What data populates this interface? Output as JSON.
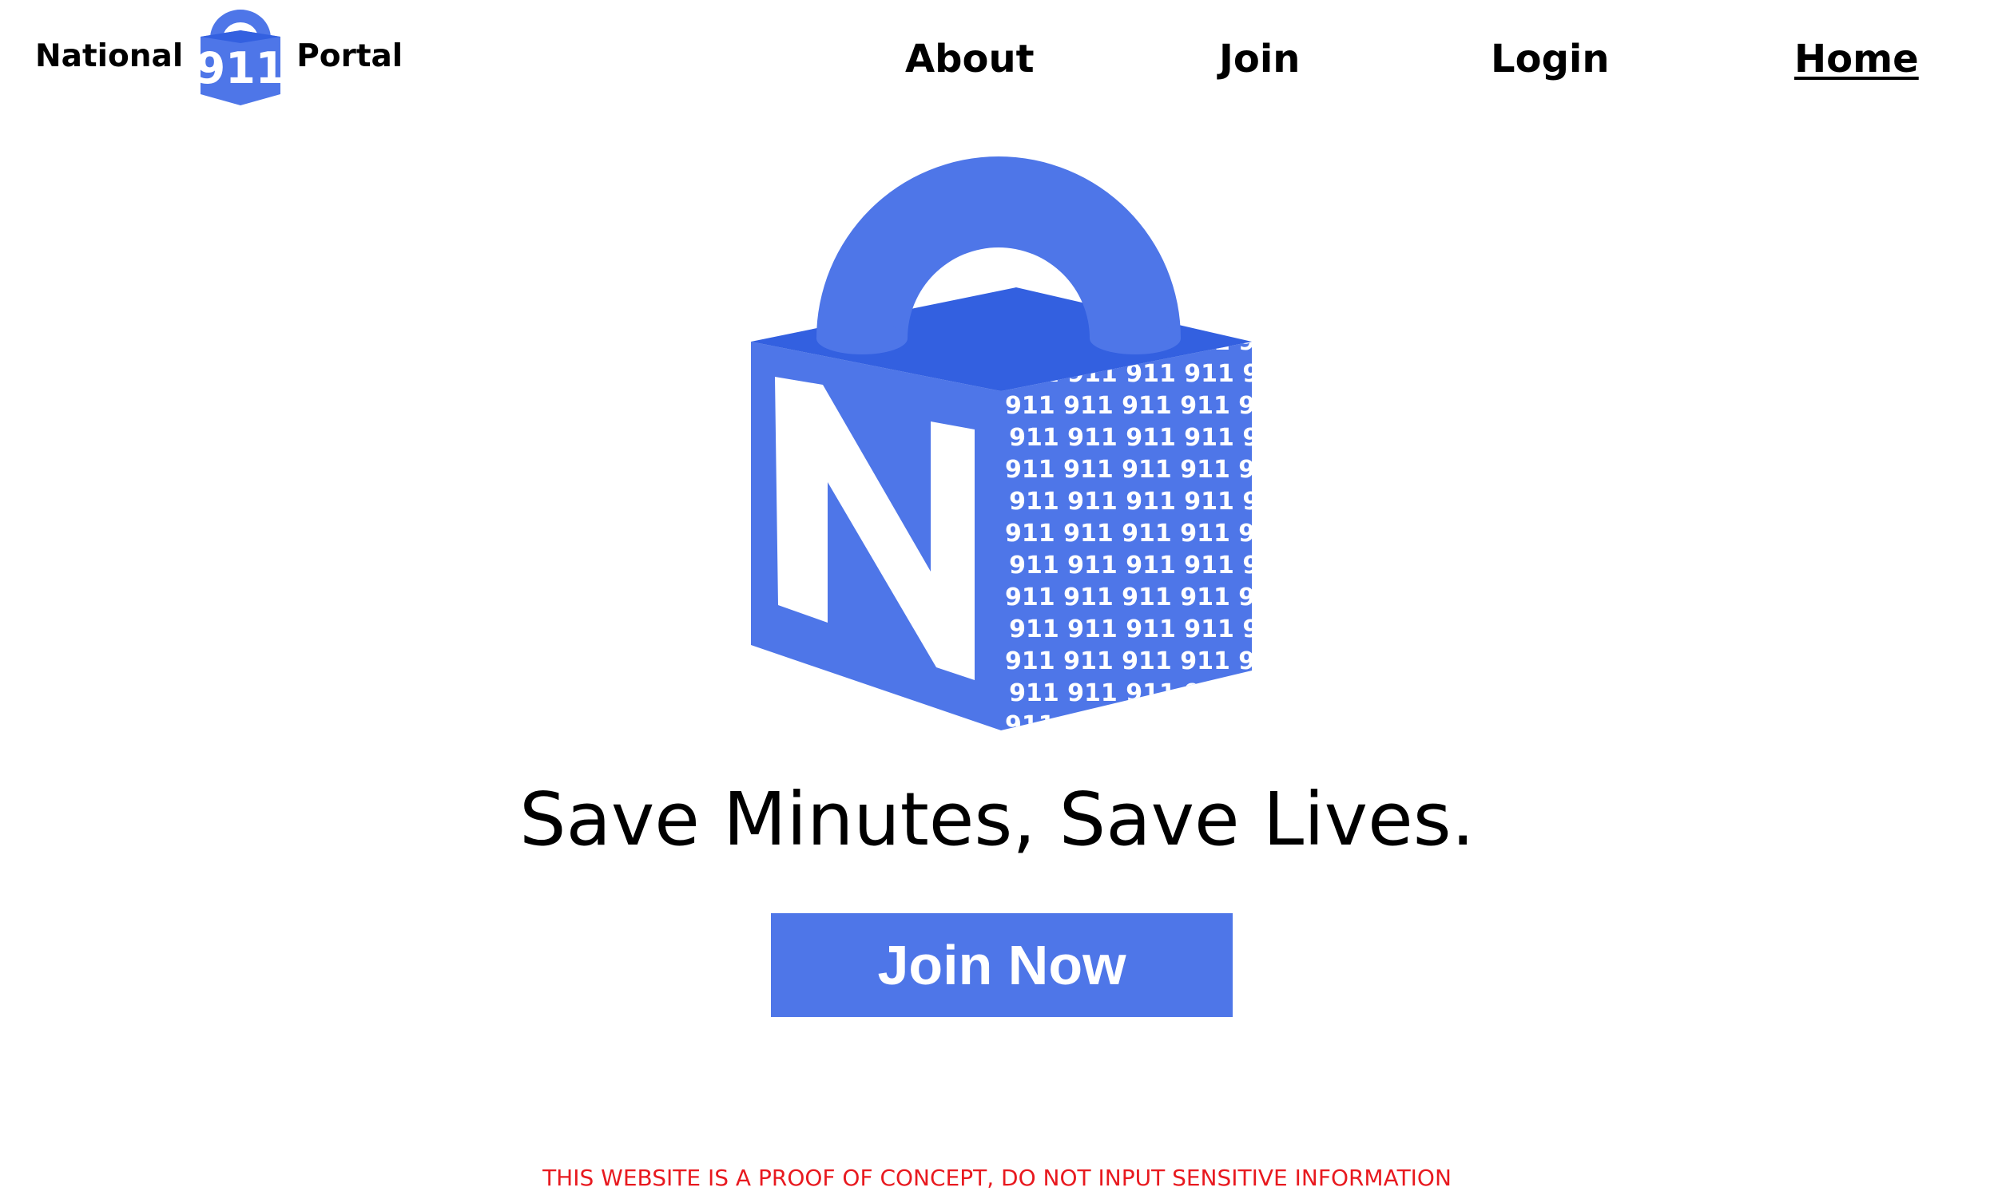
{
  "brand": {
    "left_word": "National",
    "logo_number": "911",
    "right_word": "Portal"
  },
  "nav": {
    "about": "About",
    "join": "Join",
    "login": "Login",
    "home": "Home",
    "active": "home"
  },
  "hero": {
    "logo_letter": "N",
    "pattern_text": "911",
    "tagline": "Save Minutes, Save Lives.",
    "cta_label": "Join Now"
  },
  "footer": {
    "disclaimer": "THIS WEBSITE IS A PROOF OF CONCEPT, DO NOT INPUT SENSITIVE INFORMATION"
  },
  "colors": {
    "brand_blue": "#4e76e8",
    "brand_blue_dark": "#3360e0",
    "disclaimer_red": "#e8191f",
    "text": "#000000",
    "background": "#ffffff"
  },
  "icons": {
    "brand_logo": "padlock-911-icon",
    "hero_logo": "padlock-cube-n-icon"
  }
}
